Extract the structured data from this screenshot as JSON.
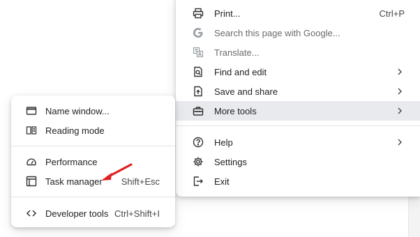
{
  "main_menu": {
    "items": [
      {
        "label": "Print...",
        "shortcut": "Ctrl+P",
        "icon": "print-icon"
      },
      {
        "label": "Search this page with Google...",
        "icon": "google-icon"
      },
      {
        "label": "Translate...",
        "icon": "translate-icon"
      },
      {
        "label": "Find and edit",
        "icon": "find-edit-icon"
      },
      {
        "label": "Save and share",
        "icon": "save-share-icon"
      },
      {
        "label": "More tools",
        "icon": "toolbox-icon"
      },
      {
        "label": "Help",
        "icon": "help-icon"
      },
      {
        "label": "Settings",
        "icon": "gear-icon"
      },
      {
        "label": "Exit",
        "icon": "exit-icon"
      }
    ]
  },
  "sub_menu": {
    "items": [
      {
        "label": "Name window...",
        "icon": "window-icon"
      },
      {
        "label": "Reading mode",
        "icon": "book-icon"
      },
      {
        "label": "Performance",
        "icon": "speedometer-icon"
      },
      {
        "label": "Task manager",
        "shortcut": "Shift+Esc",
        "icon": "task-manager-icon"
      },
      {
        "label": "Developer tools",
        "shortcut": "Ctrl+Shift+I",
        "icon": "code-icon"
      }
    ]
  },
  "colors": {
    "highlight": "#e8eaed",
    "annotation_arrow": "#e02020",
    "text": "#1f1f1f",
    "disabled": "#6b6b6b"
  }
}
